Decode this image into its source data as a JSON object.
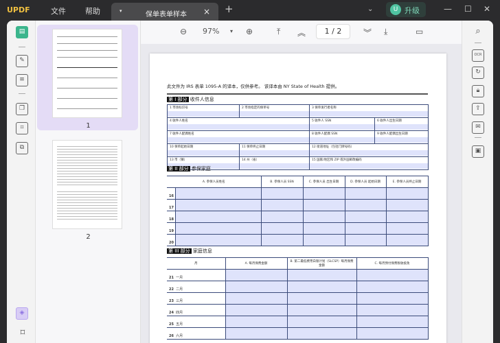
{
  "titlebar": {
    "logo": "UPDF",
    "menu": [
      "文件",
      "帮助"
    ],
    "tab_title": "保单表单样本",
    "upgrade": "升级",
    "avatar": "U"
  },
  "toolbar": {
    "zoom": "97%",
    "page": "1 / 2"
  },
  "thumbnails": [
    {
      "label": "1"
    },
    {
      "label": "2"
    }
  ],
  "doc": {
    "intro": "此文件为 IRS 表单 1095-A 的译本，仅供参考。 该译本由 NY State of Health 提供。",
    "part1": {
      "tag": "第 I 部分",
      "title": "收件人信息",
      "fields": [
        "1 市场标识号",
        "2 市场指定的保单号",
        "3 保单发行者名称",
        "4 收件人姓名",
        "5 收件人 SSN",
        "6 收件人出生日期",
        "7 收件人配偶姓名",
        "8 收件人配偶 SSN",
        "9 收件人配偶出生日期",
        "10 保单起始日期",
        "11 保单终止日期",
        "12 街道地址（包括门牌号码）",
        "13 市（镇）",
        "14 州（省）",
        "15 国家/地区和 ZIP 或外国邮政编码"
      ]
    },
    "part2": {
      "tag": "第 II 部分",
      "title": "参保家庭",
      "headers": [
        "A. 参保人员姓名",
        "B. 参保人员 SSN",
        "C. 参保人员 出生日期",
        "D. 参保人员 起始日期",
        "E. 参保人员终止日期"
      ],
      "rows": [
        "16",
        "17",
        "18",
        "19",
        "20"
      ]
    },
    "part3": {
      "tag": "第 III 部分",
      "title": "家庭信息",
      "headers": [
        "月",
        "A. 每月保费金额",
        "B. 第二最低费用白银计划（SLCSP）每月保费金额",
        "C. 每月预付保费税收抵免"
      ],
      "rows": [
        {
          "n": "21",
          "m": "一月"
        },
        {
          "n": "22",
          "m": "二月"
        },
        {
          "n": "23",
          "m": "三月"
        },
        {
          "n": "24",
          "m": "四月"
        },
        {
          "n": "25",
          "m": "五月"
        },
        {
          "n": "26",
          "m": "六月"
        }
      ]
    }
  }
}
